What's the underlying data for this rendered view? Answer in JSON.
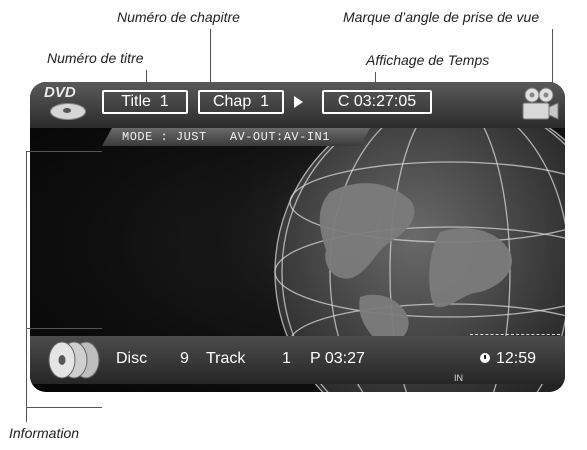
{
  "callouts": {
    "chapter_number": "Numéro de chapitre",
    "angle_mark": "Marque d’angle de prise de vue",
    "title_number": "Numéro de titre",
    "time_display": "Affichage de Temps",
    "information": "Information"
  },
  "osd": {
    "logo": "DVD",
    "title_box": "Title  1",
    "chapter_box": "Chap  1",
    "play_icon": "play-triangle",
    "time_box": "C 03:27:05",
    "mode_line": "MODE : JUST   AV-OUT:AV-IN1",
    "angle_icon": "camera-angle"
  },
  "status": {
    "disc": "Disc",
    "disc_no": "9",
    "track": "Track",
    "track_no": "1",
    "position": "P 03:27",
    "clock_icon": "clock",
    "clock": "12:59",
    "input": "IN",
    "discs_icon": "multi-disc-changer"
  },
  "colors": {
    "screen_bg": "#0a0a0a",
    "bar": "#3c3c3c",
    "text": "#ffffff",
    "callout_text": "#222222",
    "leader": "#555555"
  }
}
